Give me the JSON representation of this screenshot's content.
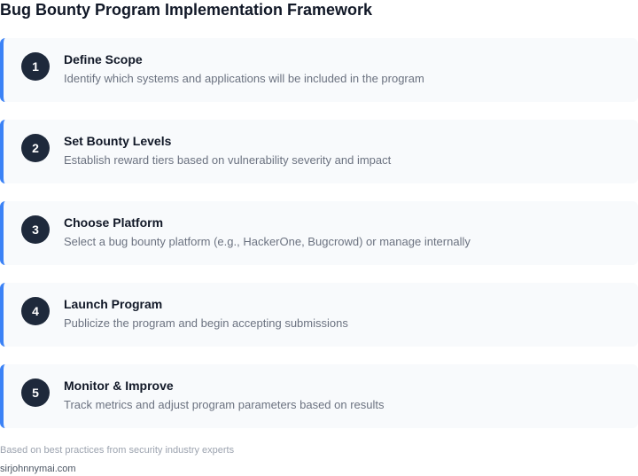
{
  "title": "Bug Bounty Program Implementation Framework",
  "steps": [
    {
      "number": "1",
      "title": "Define Scope",
      "description": "Identify which systems and applications will be included in the program"
    },
    {
      "number": "2",
      "title": "Set Bounty Levels",
      "description": "Establish reward tiers based on vulnerability severity and impact"
    },
    {
      "number": "3",
      "title": "Choose Platform",
      "description": "Select a bug bounty platform (e.g., HackerOne, Bugcrowd) or manage internally"
    },
    {
      "number": "4",
      "title": "Launch Program",
      "description": "Publicize the program and begin accepting submissions"
    },
    {
      "number": "5",
      "title": "Monitor & Improve",
      "description": "Track metrics and adjust program parameters based on results"
    }
  ],
  "footer": {
    "note": "Based on best practices from security industry experts",
    "site": "sirjohnnymai.com"
  },
  "colors": {
    "accent": "#3b82f6",
    "step_background": "#f8fafc",
    "badge": "#1e293b"
  }
}
